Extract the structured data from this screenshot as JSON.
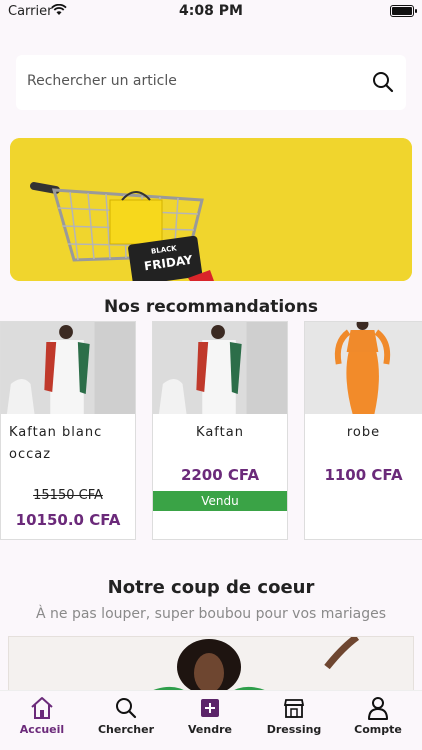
{
  "status_bar": {
    "carrier": "Carrier",
    "time": "4:08 PM"
  },
  "search": {
    "placeholder": "Rechercher un article"
  },
  "banner": {
    "tag_line1": "BLACK",
    "tag_line2": "FRIDAY"
  },
  "recommendations": {
    "title": "Nos recommandations",
    "items": [
      {
        "name": "Kaftan blanc occaz",
        "old_price": "15150 CFA",
        "price": "10150.0 CFA",
        "sold": false
      },
      {
        "name": "Kaftan",
        "price": "2200 CFA",
        "sold": true,
        "sold_label": "Vendu"
      },
      {
        "name": "robe",
        "price": "1100 CFA",
        "sold": false
      }
    ]
  },
  "coup_de_coeur": {
    "title": "Notre coup de coeur",
    "subtitle": "À ne pas louper, super boubou pour vos mariages"
  },
  "tabbar": {
    "tabs": [
      {
        "label": "Accueil",
        "icon": "home-icon",
        "active": true
      },
      {
        "label": "Chercher",
        "icon": "search-icon"
      },
      {
        "label": "Vendre",
        "icon": "add-icon"
      },
      {
        "label": "Dressing",
        "icon": "store-icon"
      },
      {
        "label": "Compte",
        "icon": "user-icon"
      }
    ]
  },
  "colors": {
    "accent": "#6b2a7a",
    "sold": "#3aa346",
    "banner": "#f0d52d"
  }
}
